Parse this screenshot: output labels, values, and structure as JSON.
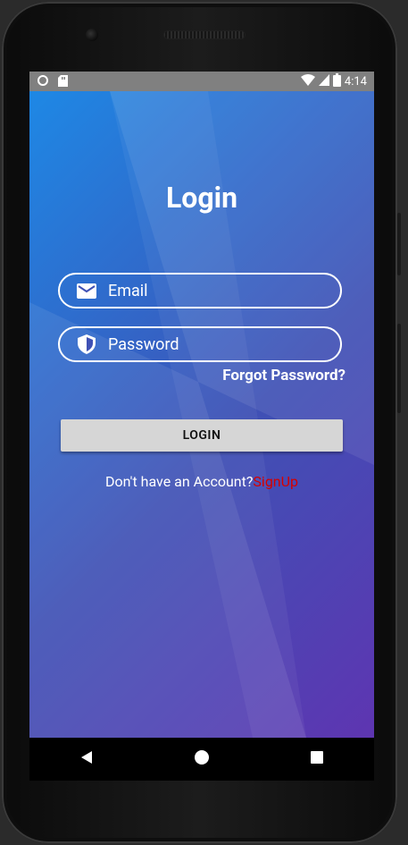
{
  "status_bar": {
    "time": "4:14"
  },
  "login": {
    "title": "Login",
    "email_placeholder": "Email",
    "password_placeholder": "Password",
    "forgot_password": "Forgot Password?",
    "login_button": "LOGIN",
    "no_account_text": "Don't have an Account?",
    "signup_link": "SignUp"
  },
  "icons": {
    "email": "mail-icon",
    "password": "shield-icon",
    "nav_back": "back-triangle-icon",
    "nav_home": "home-circle-icon",
    "nav_recents": "recents-square-icon"
  },
  "colors": {
    "gradient_start": "#1e88e5",
    "gradient_mid": "#3f51b5",
    "gradient_end": "#5e35b1",
    "signup_link": "#d50000",
    "button_bg": "#d6d6d6",
    "status_bar_bg": "#808080"
  }
}
